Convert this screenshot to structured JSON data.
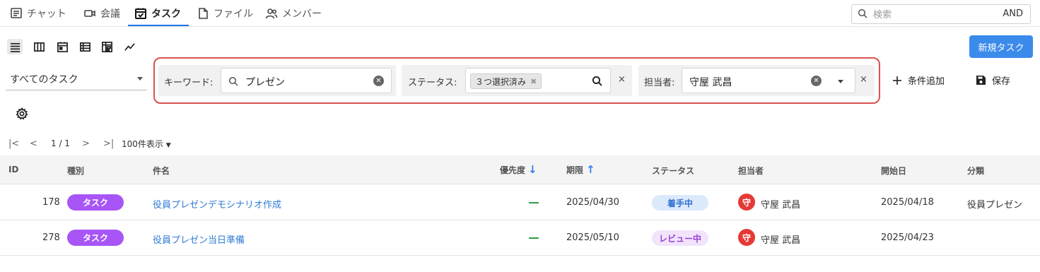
{
  "nav": {
    "tabs": [
      {
        "label": "チャット"
      },
      {
        "label": "会議"
      },
      {
        "label": "タスク"
      },
      {
        "label": "ファイル"
      },
      {
        "label": "メンバー"
      }
    ],
    "active_tab": "タスク",
    "search_placeholder": "検索",
    "search_mode": "AND"
  },
  "toolbar": {
    "views": [
      "list-view-icon",
      "board-view-icon",
      "calendar-view-icon",
      "table-view-icon",
      "gantt-view-icon",
      "chart-view-icon"
    ],
    "new_task_label": "新規タスク"
  },
  "filters": {
    "scope": "すべてのタスク",
    "keyword": {
      "label": "キーワード:",
      "value": "プレゼン"
    },
    "status": {
      "label": "ステータス:",
      "chip": "３つ選択済み"
    },
    "assignee": {
      "label": "担当者:",
      "value": "守屋 武昌"
    },
    "add_condition_label": "条件追加",
    "save_label": "保存"
  },
  "pagination": {
    "page": "1 / 1",
    "per_page": "100件表示"
  },
  "table": {
    "headers": {
      "id": "ID",
      "type": "種別",
      "title": "件名",
      "priority": "優先度",
      "due": "期限",
      "status": "ステータス",
      "assignee": "担当者",
      "start": "開始日",
      "category": "分類"
    },
    "rows": [
      {
        "id": "178",
        "type": "タスク",
        "title": "役員プレゼンデモシナリオ作成",
        "due": "2025/04/30",
        "status": "着手中",
        "assignee_initial": "守",
        "assignee": "守屋 武昌",
        "start": "2025/04/18",
        "category": "役員プレゼン"
      },
      {
        "id": "278",
        "type": "タスク",
        "title": "役員プレゼン当日準備",
        "due": "2025/05/10",
        "status": "レビュー中",
        "assignee_initial": "守",
        "assignee": "守屋 武昌",
        "start": "2025/04/23",
        "category": ""
      }
    ]
  },
  "colors": {
    "accent": "#3b8beb",
    "task_badge": "#a855f7",
    "status_in_progress_bg": "#dbe9fb",
    "status_in_progress_fg": "#2f6fd0",
    "status_review_bg": "#f1e4fb",
    "status_review_fg": "#9b3fd6",
    "avatar": "#e53935",
    "highlight": "#d9534f"
  }
}
